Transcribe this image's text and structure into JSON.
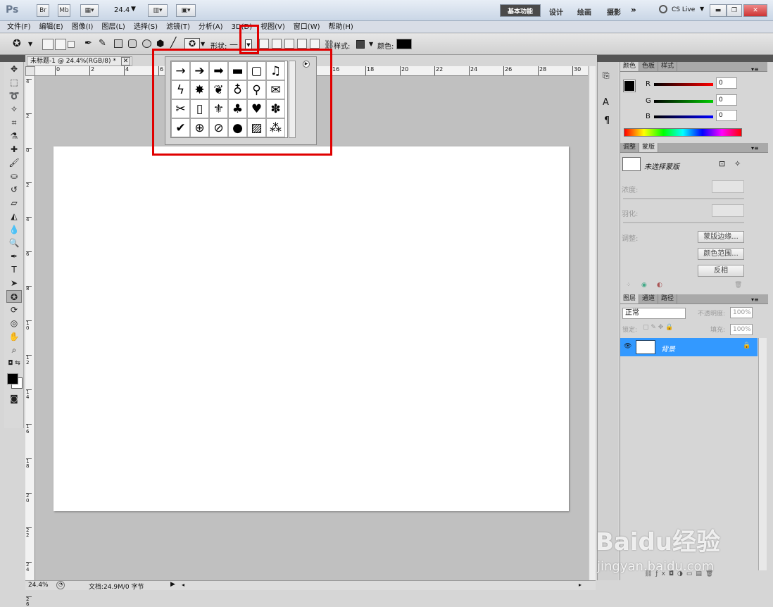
{
  "app": {
    "logo": "Ps",
    "zoom_value": "24.4"
  },
  "titlebar": {
    "app_buttons": [
      "Br",
      "Mb"
    ],
    "workspaces": [
      "基本功能",
      "设计",
      "绘画",
      "摄影"
    ],
    "more": "»",
    "cslive": "CS Live"
  },
  "menu": [
    "文件(F)",
    "编辑(E)",
    "图像(I)",
    "图层(L)",
    "选择(S)",
    "滤镜(T)",
    "分析(A)",
    "3D(D)",
    "视图(V)",
    "窗口(W)",
    "帮助(H)"
  ],
  "options": {
    "shape_label": "形状:",
    "style_label": "样式:",
    "color_label": "颜色:",
    "color": "#000000"
  },
  "document": {
    "tab_title": "未标题-1 @ 24.4%(RGB/8) *",
    "ruler_h": [
      "0",
      "2",
      "4",
      "6",
      "8",
      "10",
      "12",
      "14",
      "16",
      "18",
      "20",
      "22",
      "24",
      "26",
      "28",
      "30"
    ],
    "ruler_v": [
      "4",
      "2",
      "0",
      "2",
      "4",
      "6",
      "8",
      "10",
      "12",
      "14",
      "16",
      "18",
      "20",
      "22",
      "24",
      "26"
    ]
  },
  "status": {
    "zoom": "24.4%",
    "doc": "文档:24.9M/0 字节"
  },
  "shape_picker": {
    "shapes": [
      "→",
      "➔",
      "➡",
      "▬",
      "▢",
      "♫",
      "ϟ",
      "✸",
      "❦",
      "♁",
      "⚲",
      "✉",
      "✂",
      "▯",
      "⚜",
      "♣",
      "♥",
      "✽",
      "✔",
      "⊕",
      "⊘",
      "●",
      "▨",
      "⁂"
    ]
  },
  "color_panel": {
    "tabs": [
      "颜色",
      "色板",
      "样式"
    ],
    "channels": [
      {
        "label": "R",
        "value": "0"
      },
      {
        "label": "G",
        "value": "0"
      },
      {
        "label": "B",
        "value": "0"
      }
    ]
  },
  "mask_panel": {
    "tabs": [
      "调整",
      "蒙版"
    ],
    "title": "未选择蒙版",
    "density": "浓度:",
    "feather": "羽化:",
    "adjust": "调整:",
    "buttons": [
      "蒙版边缘...",
      "颜色范围...",
      "反相"
    ]
  },
  "layers_panel": {
    "tabs": [
      "图层",
      "通道",
      "路径"
    ],
    "blend_mode": "正常",
    "opacity_label": "不透明度:",
    "opacity": "100%",
    "lock_label": "锁定:",
    "fill_label": "填充:",
    "fill": "100%",
    "layer_name": "背景"
  },
  "watermark": {
    "brand": "Baidu经验",
    "url": "jingyan.baidu.com"
  },
  "colors": {
    "accent": "#3399ff",
    "highlight": "#e00000"
  }
}
